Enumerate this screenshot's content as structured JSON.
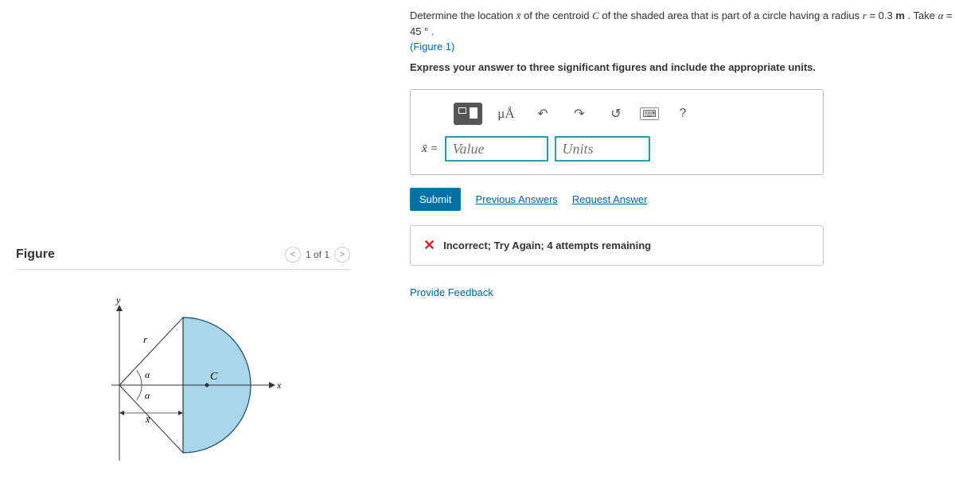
{
  "problem": {
    "text_part1": "Determine the location ",
    "xbar": "x̄",
    "text_part2": " of the centroid ",
    "C": "C",
    "text_part3": " of the shaded area that is part of a circle having a radius ",
    "r": "r",
    "eq1": " = 0.3 ",
    "m": "m",
    "text_part4": " . Take ",
    "alpha": "α",
    "eq2": " = 45 ° .",
    "figure_link": "(Figure 1)",
    "instruction": "Express your answer to three significant figures and include the appropriate units."
  },
  "toolbar": {
    "units_symbol": "μÅ",
    "undo": "↶",
    "redo": "↷",
    "reset": "↺",
    "keyboard": "⌨",
    "help": "?"
  },
  "input": {
    "label": "x̄ =",
    "value_placeholder": "Value",
    "units_placeholder": "Units"
  },
  "actions": {
    "submit": "Submit",
    "previous": "Previous Answers",
    "request": "Request Answer"
  },
  "feedback": {
    "icon": "✕",
    "text": "Incorrect; Try Again; 4 attempts remaining"
  },
  "provide_feedback": "Provide Feedback",
  "figure": {
    "title": "Figure",
    "pager": "1 of 1",
    "labels": {
      "y": "y",
      "x": "x",
      "r": "r",
      "alpha": "α",
      "C": "C",
      "xbar": "x̄"
    }
  }
}
